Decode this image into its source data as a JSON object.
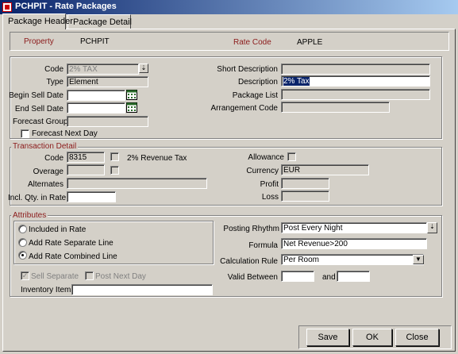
{
  "window": {
    "title": "PCHPIT - Rate Packages"
  },
  "tabs": [
    {
      "label": "Package Header"
    },
    {
      "label": "Package Detail"
    }
  ],
  "header": {
    "property_label": "Property",
    "property_value": "PCHPIT",
    "rate_code_label": "Rate Code",
    "rate_code_value": "APPLE"
  },
  "general": {
    "code_label": "Code",
    "code_value": "2% TAX",
    "type_label": "Type",
    "type_value": "Element",
    "begin_sell_label": "Begin Sell Date",
    "begin_sell_value": "",
    "end_sell_label": "End Sell Date",
    "end_sell_value": "",
    "forecast_group_label": "Forecast Group",
    "forecast_group_value": "",
    "forecast_next_day_label": "Forecast Next Day",
    "short_desc_label": "Short Description",
    "short_desc_value": "",
    "description_label": "Description",
    "description_value": "2% Tax",
    "package_list_label": "Package List",
    "package_list_value": "",
    "arrangement_label": "Arrangement Code",
    "arrangement_value": ""
  },
  "transaction": {
    "group_label": "Transaction Detail",
    "code_label": "Code",
    "code_value": "8315",
    "code_desc": "2% Revenue Tax",
    "overage_label": "Overage",
    "overage_value": "",
    "alternates_label": "Alternates",
    "alternates_value": "",
    "incl_qty_label": "Incl. Qty. in Rate",
    "incl_qty_value": "",
    "allowance_label": "Allowance",
    "currency_label": "Currency",
    "currency_value": "EUR",
    "profit_label": "Profit",
    "profit_value": "",
    "loss_label": "Loss",
    "loss_value": ""
  },
  "attributes": {
    "group_label": "Attributes",
    "options": [
      {
        "label": "Included in Rate",
        "selected": false
      },
      {
        "label": "Add Rate Separate Line",
        "selected": false
      },
      {
        "label": "Add Rate Combined Line",
        "selected": true
      }
    ],
    "sell_separate_label": "Sell Separate",
    "post_next_day_label": "Post Next Day",
    "inventory_label": "Inventory Items",
    "inventory_value": "",
    "posting_rhythm_label": "Posting Rhythm",
    "posting_rhythm_value": "Post Every Night",
    "formula_label": "Formula",
    "formula_value": "Net Revenue>200",
    "calc_rule_label": "Calculation Rule",
    "calc_rule_value": "Per Room",
    "valid_between_label": "Valid Between",
    "valid_from_value": "",
    "and_label": "and",
    "valid_to_value": ""
  },
  "buttons": {
    "save": "Save",
    "ok": "OK",
    "close": "Close"
  },
  "icons": {
    "window": "app-icon",
    "calendar": "calendar-icon",
    "dropdown": "chevron-down-icon",
    "lookup": "lookup-arrow-icon"
  }
}
